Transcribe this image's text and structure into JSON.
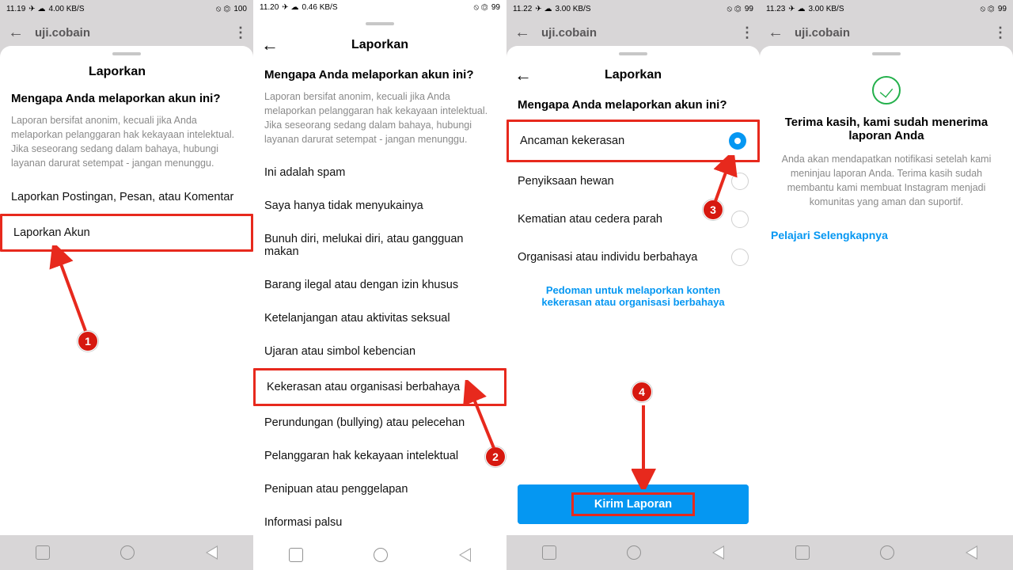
{
  "status": {
    "p1": {
      "time": "11.19",
      "net": "4.00 KB/S",
      "right": "100"
    },
    "p2": {
      "time": "11.20",
      "net": "0.46 KB/S",
      "right": "99"
    },
    "p3": {
      "time": "11.22",
      "net": "3.00 KB/S",
      "right": "99"
    },
    "p4": {
      "time": "11.23",
      "net": "3.00 KB/S",
      "right": "99"
    }
  },
  "username": "uji.cobain",
  "sheet_title": "Laporkan",
  "question": "Mengapa Anda melaporkan akun ini?",
  "anonymous_desc": "Laporan bersifat anonim, kecuali jika Anda melaporkan pelanggaran hak kekayaan intelektual. Jika seseorang sedang dalam bahaya, hubungi layanan darurat setempat - jangan menunggu.",
  "panel1": {
    "opt1": "Laporkan Postingan, Pesan, atau Komentar",
    "opt2": "Laporkan Akun"
  },
  "panel2": {
    "reasons": [
      "Ini adalah spam",
      "Saya hanya tidak menyukainya",
      "Bunuh diri, melukai diri, atau gangguan makan",
      "Barang ilegal atau dengan izin khusus",
      "Ketelanjangan atau aktivitas seksual",
      "Ujaran atau simbol kebencian",
      "Kekerasan atau organisasi berbahaya",
      "Perundungan (bullying) atau pelecehan",
      "Pelanggaran hak kekayaan intelektual",
      "Penipuan atau penggelapan",
      "Informasi palsu"
    ]
  },
  "panel3": {
    "subreasons": [
      "Ancaman kekerasan",
      "Penyiksaan hewan",
      "Kematian atau cedera parah",
      "Organisasi atau individu berbahaya"
    ],
    "guidelines_link": "Pedoman untuk melaporkan konten kekerasan atau organisasi berbahaya",
    "submit": "Kirim Laporan"
  },
  "panel4": {
    "thanks_title": "Terima kasih, kami sudah menerima laporan Anda",
    "thanks_desc": "Anda akan mendapatkan notifikasi setelah kami meninjau laporan Anda. Terima kasih sudah membantu kami membuat Instagram menjadi komunitas yang aman dan suportif.",
    "learn_more": "Pelajari Selengkapnya"
  },
  "markers": {
    "m1": "1",
    "m2": "2",
    "m3": "3",
    "m4": "4"
  }
}
